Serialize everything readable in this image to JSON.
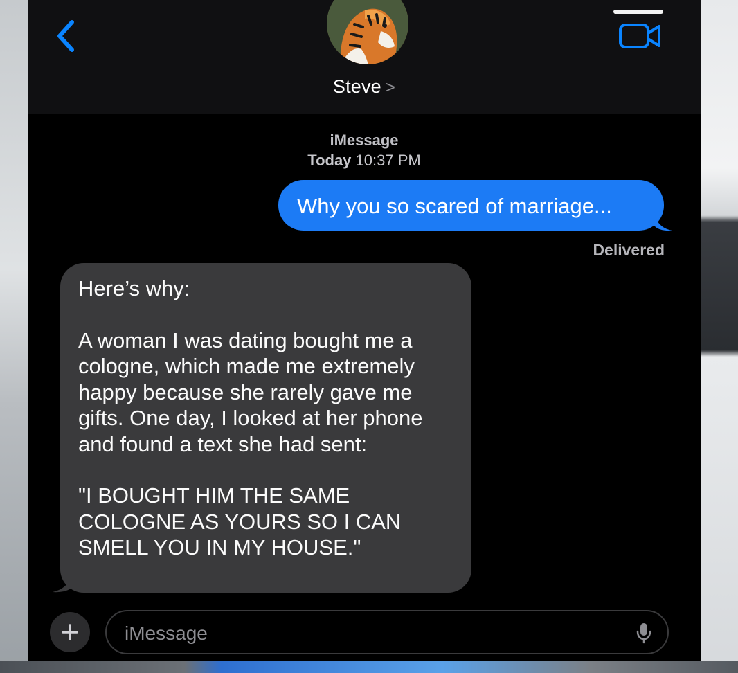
{
  "header": {
    "contact_name": "Steve",
    "contact_chevron": ">"
  },
  "thread": {
    "service": "iMessage",
    "day": "Today",
    "time": "10:37 PM"
  },
  "messages": [
    {
      "direction": "outgoing",
      "text": "Why you so scared of marriage...",
      "status": "Delivered"
    },
    {
      "direction": "incoming",
      "paragraphs": [
        "Here’s why:",
        "A woman I was dating bought me a cologne, which made me extremely happy because she rarely gave me gifts. One day, I looked at her phone and found a text she had sent:",
        "\"I BOUGHT HIM THE SAME COLOGNE AS YOURS SO I CAN SMELL YOU IN MY HOUSE.\""
      ]
    }
  ],
  "composer": {
    "plus_label": "+",
    "placeholder": "iMessage"
  },
  "colors": {
    "outgoing_bubble": "#1c7bf5",
    "incoming_bubble": "#3a3a3c",
    "accent": "#0a84ff",
    "background": "#000000"
  },
  "icons": {
    "back": "chevron-left-icon",
    "video": "video-camera-icon",
    "add": "plus-icon",
    "mic": "microphone-icon"
  }
}
